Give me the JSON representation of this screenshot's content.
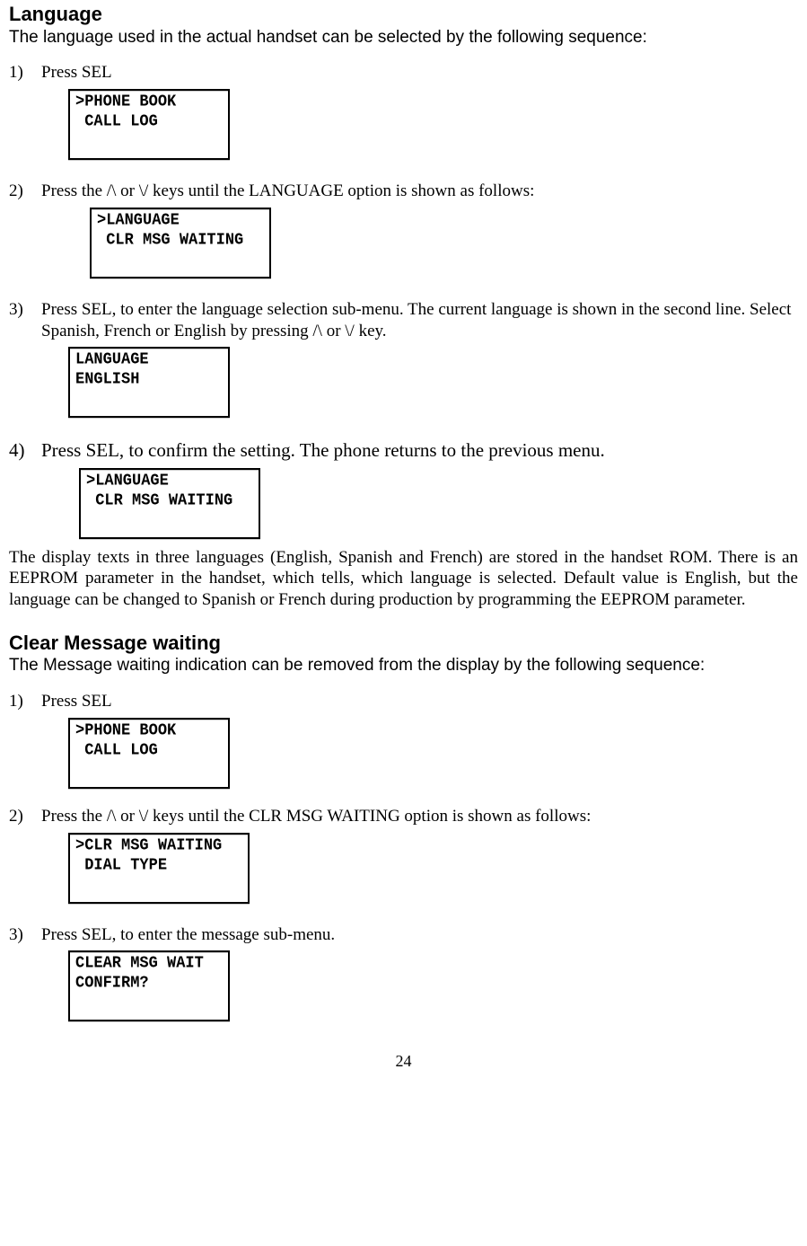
{
  "sec1": {
    "heading": "Language",
    "intro": "The language used in the actual handset can be selected by the following sequence:",
    "step1": {
      "num": "1)",
      "text": "Press SEL"
    },
    "lcd1": {
      "l1": ">PHONE BOOK",
      "l2": " CALL LOG"
    },
    "step2": {
      "num": "2)",
      "text": "Press the /\\ or \\/ keys until the LANGUAGE option is shown as follows:"
    },
    "lcd2": {
      "l1": ">LANGUAGE",
      "l2": " CLR MSG WAITING"
    },
    "step3": {
      "num": "3)",
      "text": "Press SEL, to enter the language selection sub-menu. The current language is shown in the second line. Select Spanish, French or English by pressing /\\ or \\/ key."
    },
    "lcd3": {
      "l1": "LANGUAGE",
      "l2": "ENGLISH"
    },
    "step4": {
      "num": "4)",
      "text": "Press SEL, to confirm the setting. The phone returns to the previous menu."
    },
    "lcd4": {
      "l1": ">LANGUAGE",
      "l2": " CLR MSG WAITING"
    },
    "closing": "The display texts in three languages (English, Spanish and French) are stored in the handset ROM. There is an EEPROM parameter in the handset, which tells, which language is selected. Default value is English, but the language can be changed to Spanish or French during production by programming the EEPROM parameter."
  },
  "sec2": {
    "heading": "Clear Message waiting",
    "intro": "The Message waiting indication can be removed from the display by the following sequence:",
    "step1": {
      "num": "1)",
      "text": "Press SEL"
    },
    "lcd1": {
      "l1": ">PHONE BOOK",
      "l2": " CALL LOG"
    },
    "step2": {
      "num": "2)",
      "text": "Press the /\\ or \\/ keys until the CLR MSG WAITING option is shown as follows:"
    },
    "lcd2": {
      "l1": ">CLR MSG WAITING",
      "l2": " DIAL TYPE"
    },
    "step3": {
      "num": "3)",
      "text": "Press SEL, to enter the message sub-menu."
    },
    "lcd3": {
      "l1": "CLEAR MSG WAIT",
      "l2": "CONFIRM?"
    }
  },
  "page_number": "24"
}
